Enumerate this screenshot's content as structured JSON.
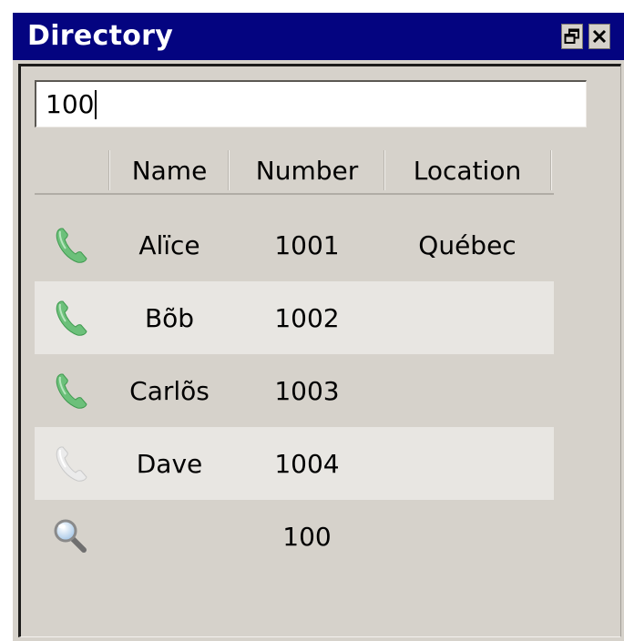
{
  "window": {
    "title": "Directory"
  },
  "search": {
    "value": "100"
  },
  "table": {
    "columns": [
      "Name",
      "Number",
      "Location"
    ],
    "rows": [
      {
        "icon": "phone-available-icon",
        "name": "Alïce",
        "number": "1001",
        "location": "Québec"
      },
      {
        "icon": "phone-available-icon",
        "name": "Bõb",
        "number": "1002",
        "location": ""
      },
      {
        "icon": "phone-available-icon",
        "name": "Carlõs",
        "number": "1003",
        "location": ""
      },
      {
        "icon": "phone-unavailable-icon",
        "name": "Dave",
        "number": "1004",
        "location": ""
      },
      {
        "icon": "magnifier-icon",
        "name": "",
        "number": "100",
        "location": ""
      }
    ]
  },
  "colors": {
    "titlebar": "#040480",
    "window_bg": "#d6d2cb",
    "alt_row": "#e8e6e2",
    "phone_green": "#6cc07a",
    "phone_gray": "#c9c9c9"
  }
}
